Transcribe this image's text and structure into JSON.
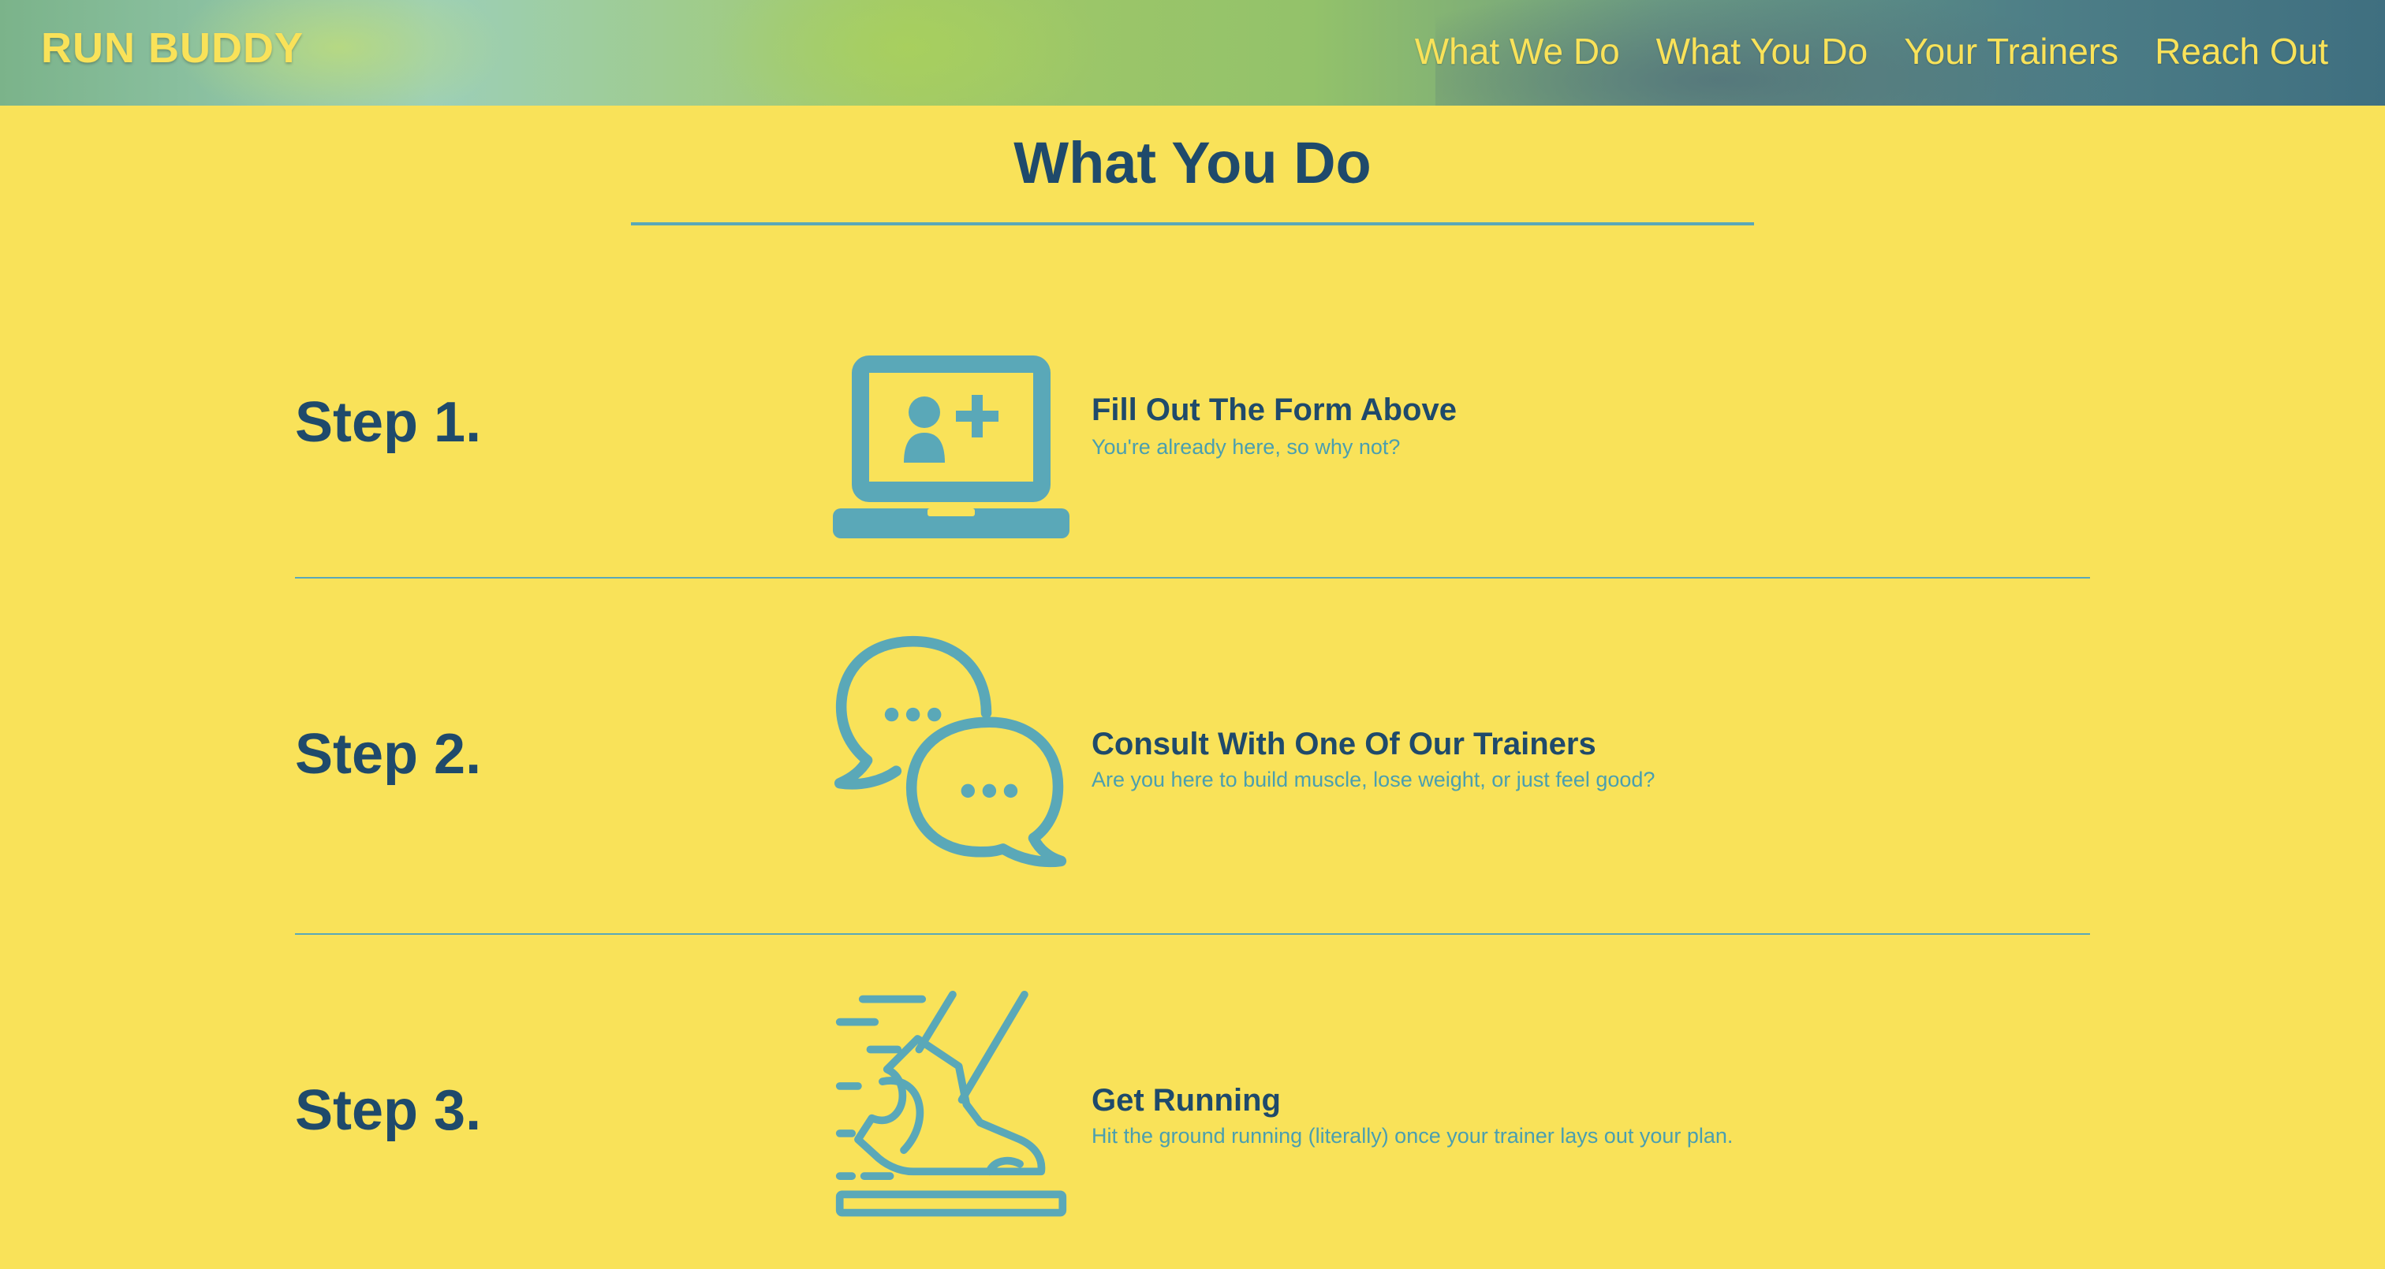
{
  "header": {
    "logo": "RUN BUDDY",
    "nav": [
      "What We Do",
      "What You Do",
      "Your Trainers",
      "Reach Out"
    ]
  },
  "section": {
    "title": "What You Do"
  },
  "steps": [
    {
      "label": "Step 1.",
      "icon": "laptop-add-user-icon",
      "heading": "Fill Out The Form Above",
      "description": "You're already here, so why not?"
    },
    {
      "label": "Step 2.",
      "icon": "chat-bubbles-icon",
      "heading": "Consult With One Of Our Trainers",
      "description": "Are you here to build muscle, lose weight, or just feel good?"
    },
    {
      "label": "Step 3.",
      "icon": "running-shoe-icon",
      "heading": "Get Running",
      "description": "Hit the ground running (literally) once your trainer lays out your plan."
    }
  ],
  "colors": {
    "background": "#f9e259",
    "heading": "#1f4a6b",
    "accent": "#5aa8b8"
  }
}
